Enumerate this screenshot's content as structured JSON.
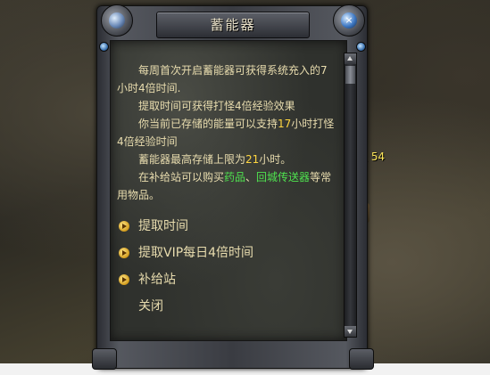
{
  "dialog": {
    "title": "蓄能器",
    "close_glyph": "×",
    "paragraphs": [
      [
        "每周首次开启蓄能器可获得系统充入的7小时4倍时间."
      ],
      [
        "提取时间可获得打怪4倍经验效果"
      ],
      [
        "你当前已存储的能量可以支持",
        "17",
        "小时打怪4倍经验时间"
      ],
      [
        "蓄能器最高存储上限为",
        "21",
        "小时。"
      ],
      [
        "在补给站可以购买",
        "药品",
        "、",
        "回城传送器",
        "等常用物品。"
      ]
    ],
    "options": [
      "提取时间",
      "提取VIP每日4倍时间",
      "补给站",
      "关闭"
    ]
  },
  "npc": {
    "label": "虫 54",
    "sub": "5"
  },
  "colors": {
    "text": "#e8dcae",
    "highlight_yellow": "#ffd640",
    "highlight_green": "#4fe24f"
  }
}
